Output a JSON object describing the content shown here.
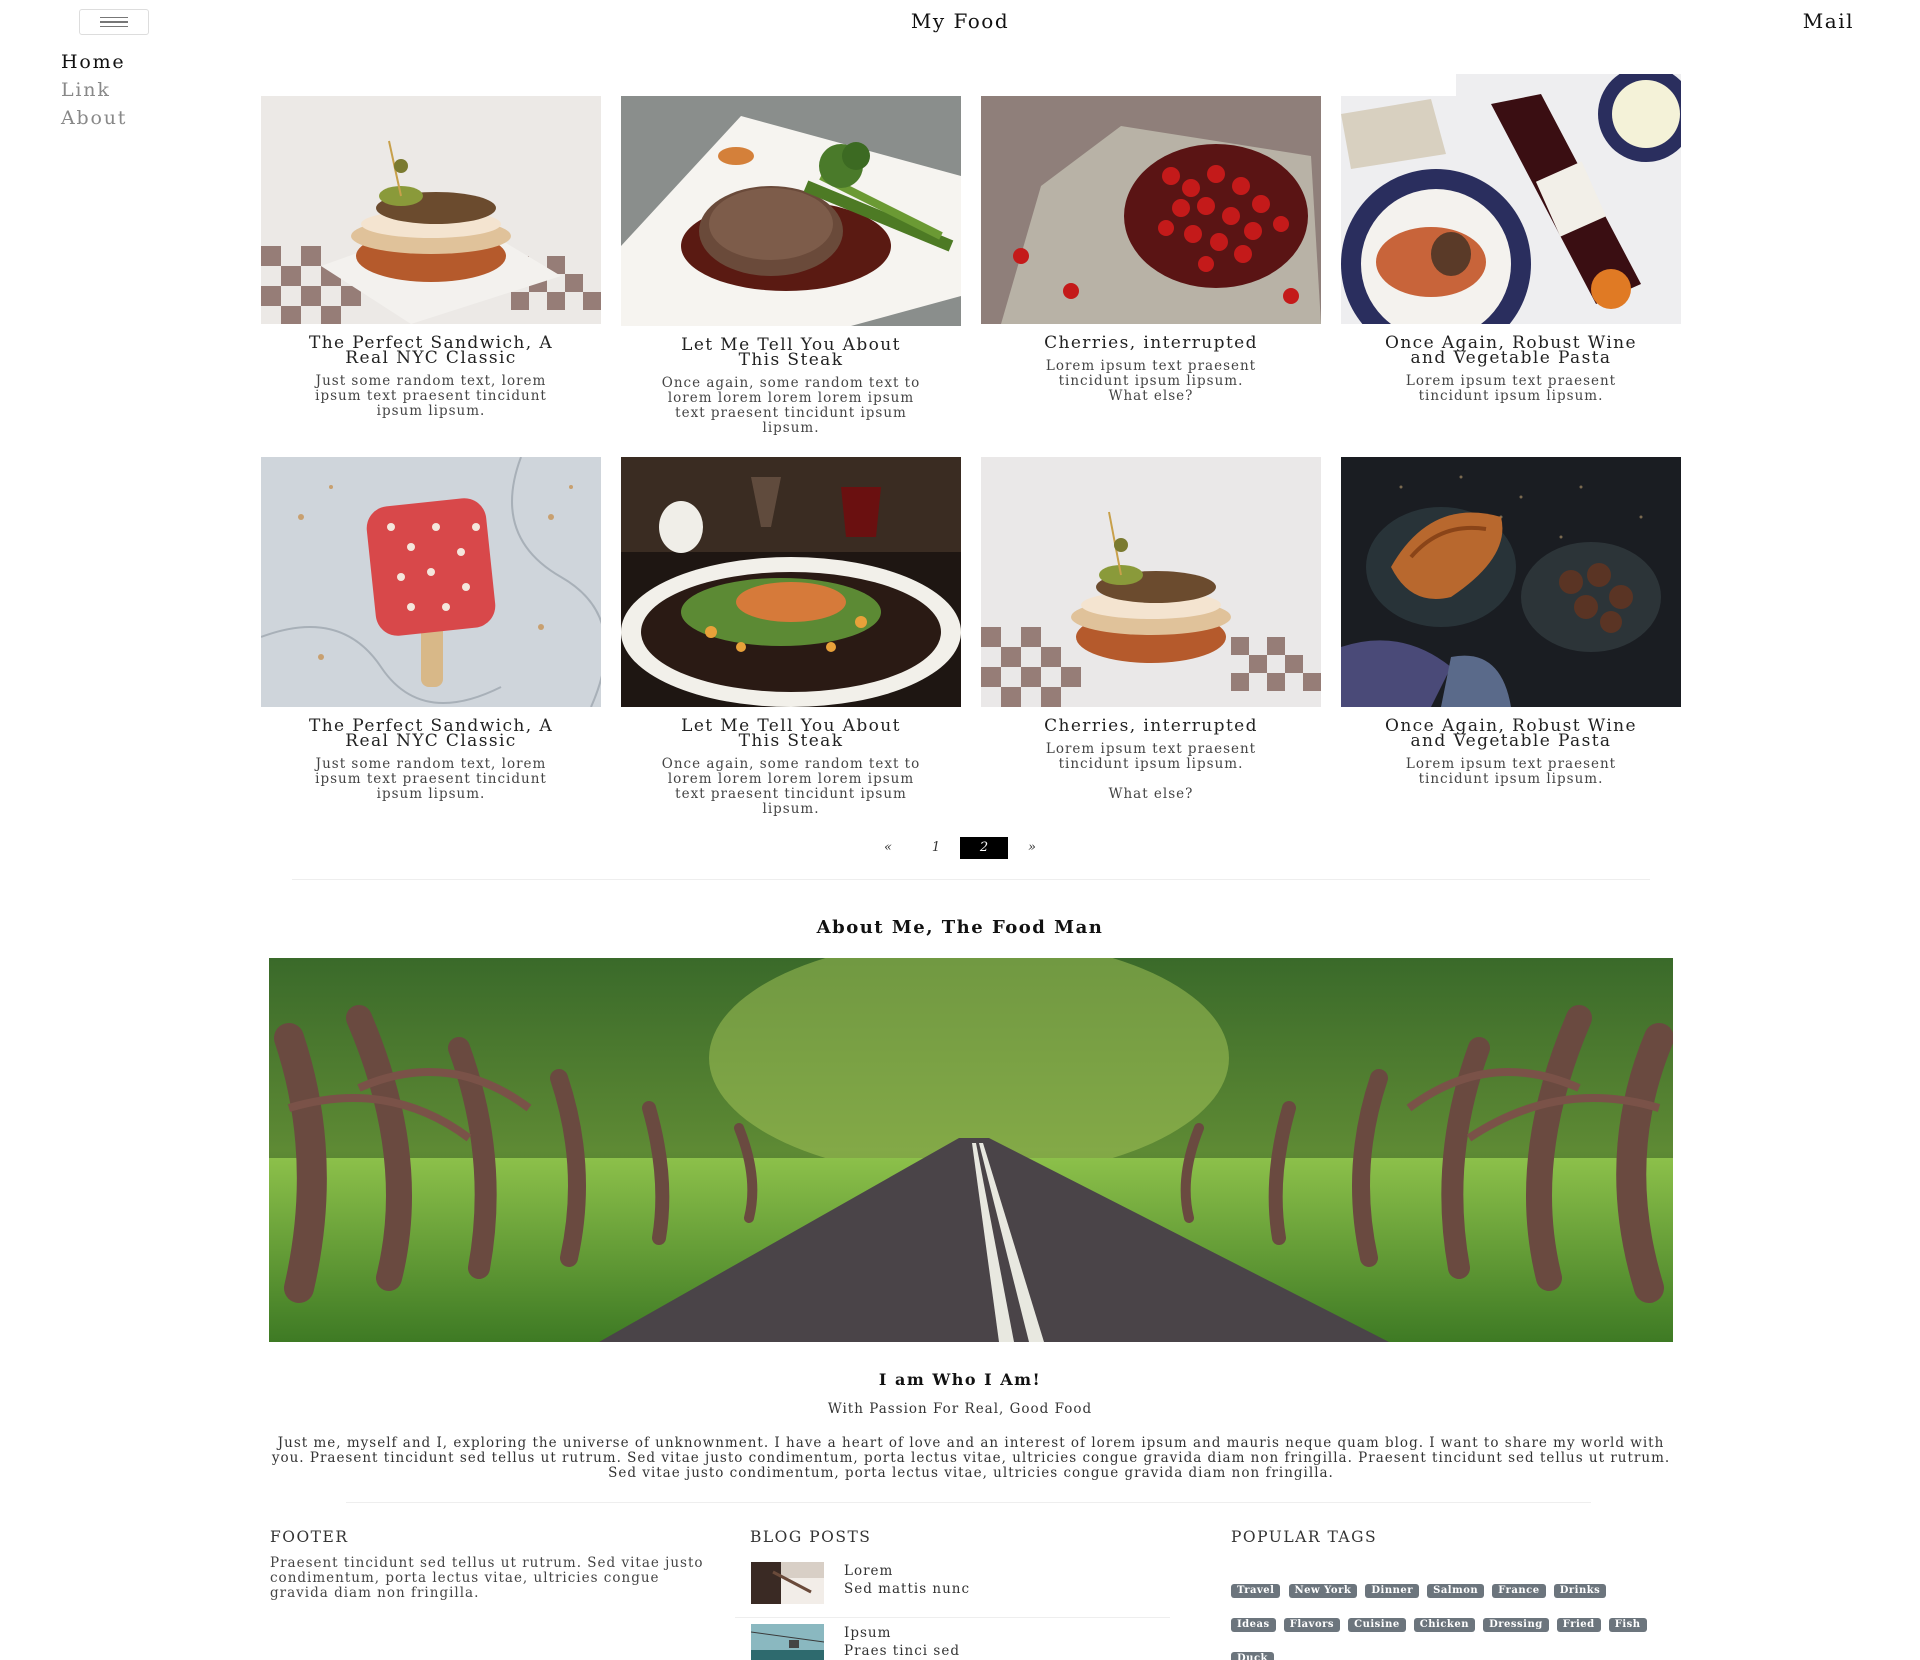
{
  "header": {
    "brand": "My Food",
    "mail": "Mail"
  },
  "sidenav": [
    "Home",
    "Link",
    "About"
  ],
  "cards": [
    {
      "title": "The Perfect Sandwich, A Real NYC Classic",
      "text": "Just some random text, lorem ipsum text praesent tincidunt ipsum lipsum."
    },
    {
      "title": "Let Me Tell You About This Steak",
      "text": "Once again, some random text to lorem lorem lorem lorem ipsum text praesent tincidunt ipsum lipsum."
    },
    {
      "title": "Cherries, interrupted",
      "text": "Lorem ipsum text praesent tincidunt ipsum lipsum.\nWhat else?"
    },
    {
      "title": "Once Again, Robust Wine and Vegetable Pasta",
      "text": "Lorem ipsum text praesent tincidunt ipsum lipsum."
    },
    {
      "title": "The Perfect Sandwich, A Real NYC Classic",
      "text": "Just some random text, lorem ipsum text praesent tincidunt ipsum lipsum."
    },
    {
      "title": "Let Me Tell You About This Steak",
      "text": "Once again, some random text to lorem lorem lorem lorem ipsum text praesent tincidunt ipsum lipsum."
    },
    {
      "title": "Cherries, interrupted",
      "text": "Lorem ipsum text praesent tincidunt ipsum lipsum.\n\nWhat else?"
    },
    {
      "title": "Once Again, Robust Wine and Vegetable Pasta",
      "text": "Lorem ipsum text praesent tincidunt ipsum lipsum."
    }
  ],
  "pagination": {
    "prev": "«",
    "pages": [
      "1",
      "2"
    ],
    "current": "2",
    "next": "»"
  },
  "about": {
    "title": "About Me, The Food Man",
    "heading": "I am Who I Am!",
    "subheading": "With Passion For Real, Good Food",
    "bio": "Just me, myself and I, exploring the universe of unknownment. I have a heart of love and an interest of lorem ipsum and mauris neque quam blog. I want to share my world with you. Praesent tincidunt sed tellus ut rutrum. Sed vitae justo condimentum, porta lectus vitae, ultricies congue gravida diam non fringilla. Praesent tincidunt sed tellus ut rutrum. Sed vitae justo condimentum, porta lectus vitae, ultricies congue gravida diam non fringilla."
  },
  "footer": {
    "col1": {
      "title": "FOOTER",
      "text": "Praesent tincidunt sed tellus ut rutrum. Sed vitae justo condimentum, porta lectus vitae, ultricies congue gravida diam non fringilla."
    },
    "col2": {
      "title": "BLOG POSTS",
      "posts": [
        {
          "title": "Lorem",
          "text": "Sed mattis nunc"
        },
        {
          "title": "Ipsum",
          "text": "Praes tinci sed"
        }
      ]
    },
    "col3": {
      "title": "POPULAR TAGS",
      "tags": [
        "Travel",
        "New York",
        "Dinner",
        "Salmon",
        "France",
        "Drinks",
        "Ideas",
        "Flavors",
        "Cuisine",
        "Chicken",
        "Dressing",
        "Fried",
        "Fish",
        "Duck"
      ]
    }
  }
}
